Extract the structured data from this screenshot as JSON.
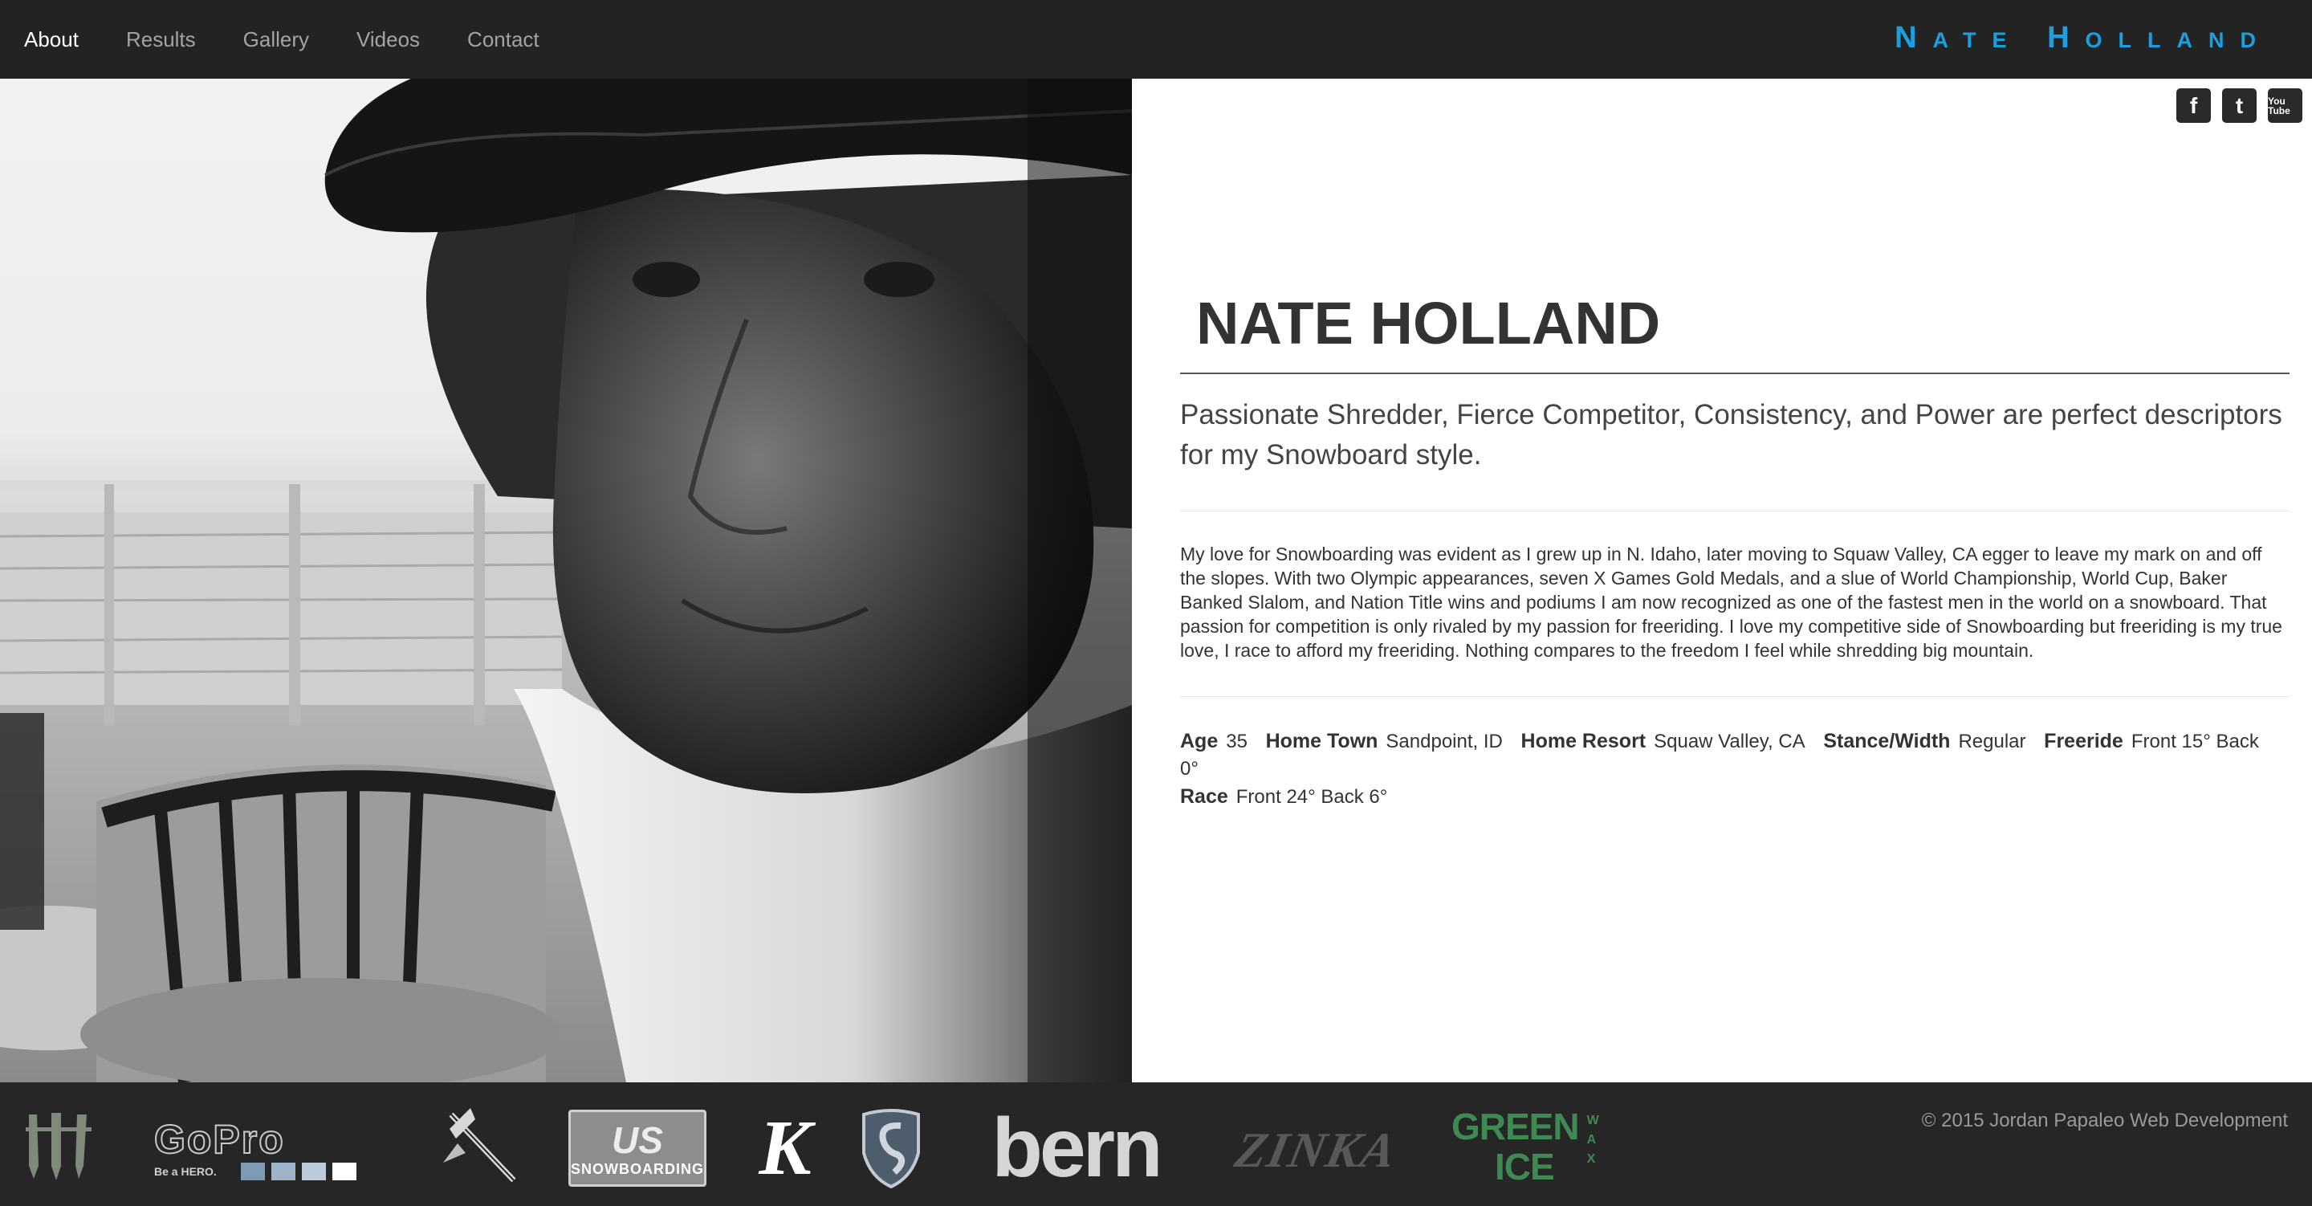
{
  "nav": {
    "items": [
      {
        "label": "About",
        "active": true
      },
      {
        "label": "Results",
        "active": false
      },
      {
        "label": "Gallery",
        "active": false
      },
      {
        "label": "Videos",
        "active": false
      },
      {
        "label": "Contact",
        "active": false
      }
    ],
    "brand": "Nate Holland",
    "brand_color": "#1a9fe0"
  },
  "social": [
    {
      "icon": "facebook-icon",
      "glyph": "f"
    },
    {
      "icon": "twitter-icon",
      "glyph": "t"
    },
    {
      "icon": "youtube-icon",
      "glyph": "You Tube"
    }
  ],
  "profile": {
    "name": "NATE HOLLAND",
    "tagline": "Passionate Shredder, Fierce Competitor, Consistency, and Power are perfect descriptors for my Snowboard style.",
    "bio": "My love for Snowboarding was evident as I grew up in N. Idaho, later moving to Squaw Valley, CA egger to leave my mark on and off the slopes. With two Olympic appearances, seven X Games Gold Medals, and a slue of World Championship, World Cup, Baker Banked Slalom, and Nation Title wins and podiums I am now recognized as one of the fastest men in the world on a snowboard. That passion for competition is only rivaled by my passion for freeriding. I love my competitive side of Snowboarding but freeriding is my true love, I race to afford my freeriding. Nothing compares to the freedom I feel while shredding big mountain.",
    "stats": {
      "age_label": "Age",
      "age": "35",
      "hometown_label": "Home Town",
      "hometown": "Sandpoint, ID",
      "resort_label": "Home Resort",
      "resort": "Squaw Valley, CA",
      "stance_label": "Stance/Width",
      "stance": "Regular",
      "freeride_label": "Freeride",
      "freeride": "Front 15°  Back 0°",
      "race_label": "Race",
      "race": "Front 24°  Back 6°"
    }
  },
  "sponsors": {
    "monster": "monster-logo",
    "gopro": "GoPro",
    "gopro_sub": "Be a HERO.",
    "axe": "axe-logo",
    "us_snowboarding": "SNOWBOARDING",
    "k": "K",
    "shield": "shield-logo",
    "bern": "bern",
    "zinka": "ZINKA",
    "green_ice_1": "GREEN",
    "green_ice_2": "ICE",
    "green_ice_wax": "WAX"
  },
  "footer": {
    "copyright": "© 2015 Jordan Papaleo Web Development"
  }
}
